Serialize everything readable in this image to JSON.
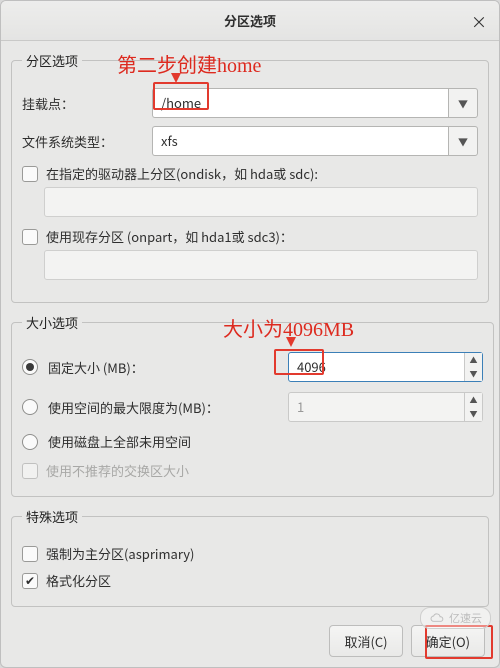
{
  "titlebar": {
    "title": "分区选项"
  },
  "annotations": {
    "step2": "第二步创建home",
    "size_note": "大小为4096MB"
  },
  "partition": {
    "legend": "分区选项",
    "mount_label": "挂载点：",
    "mount_value": "/home",
    "fs_label": "文件系统类型：",
    "fs_value": "xfs",
    "ondisk_label": "在指定的驱动器上分区(ondisk，如 hda或 sdc):",
    "onpart_label": "使用现存分区 (onpart，如 hda1或 sdc3)："
  },
  "size": {
    "legend": "大小选项",
    "fixed_label": "固定大小 (MB)：",
    "fixed_value": "4096",
    "max_label": "使用空间的最大限度为(MB)：",
    "max_value": "1",
    "fill_label": "使用磁盘上全部未用空间",
    "swap_label": "使用不推荐的交换区大小"
  },
  "special": {
    "legend": "特殊选项",
    "asprimary_label": "强制为主分区(asprimary)",
    "format_label": "格式化分区",
    "format_checked": true
  },
  "footer": {
    "cancel": "取消(C)",
    "ok": "确定(O)"
  },
  "watermark": "亿速云"
}
